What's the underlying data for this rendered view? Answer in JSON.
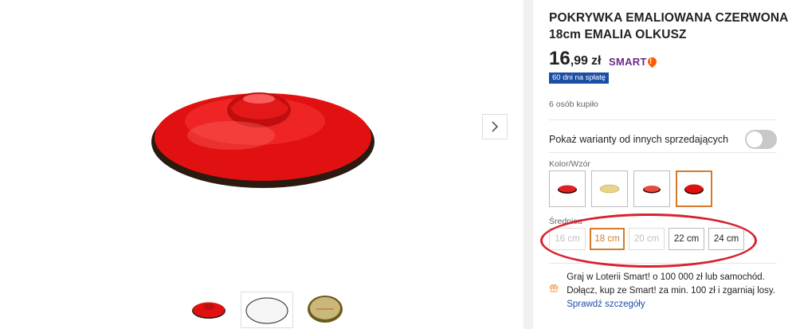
{
  "product": {
    "title": "POKRYWKA EMALIOWANA CZERWONA 18cm EMALIA OLKUSZ",
    "price_int": "16",
    "price_dec": ",99",
    "currency": "zł",
    "smart_label": "SMART",
    "installment_badge": "60 dni na spłatę",
    "buyers": "6 osób kupiło"
  },
  "variants_toggle": {
    "label": "Pokaż warianty od innych sprzedających",
    "on": false
  },
  "color_section": {
    "label": "Kolor/Wzór",
    "options": [
      {
        "name": "red-small",
        "color": "#e02020"
      },
      {
        "name": "cream",
        "color": "#e8d38a"
      },
      {
        "name": "red-light",
        "color": "#e84a3a"
      },
      {
        "name": "red-selected",
        "color": "#e01010"
      }
    ],
    "selected_index": 3
  },
  "size_section": {
    "label": "Średnica",
    "options": [
      "16 cm",
      "18 cm",
      "20 cm",
      "22 cm",
      "24 cm"
    ],
    "disabled": [
      0,
      2
    ],
    "selected_index": 1
  },
  "promo": {
    "text": "Graj w Loterii Smart! o 100 000 zł lub samochód. Dołącz, kup ze Smart! za min. 100 zł i zgarniaj losy.",
    "link": "Sprawdź szczegóły"
  },
  "colors": {
    "accent": "#d67a2a",
    "badge": "#1d4ea6",
    "highlight": "#d8222d"
  }
}
